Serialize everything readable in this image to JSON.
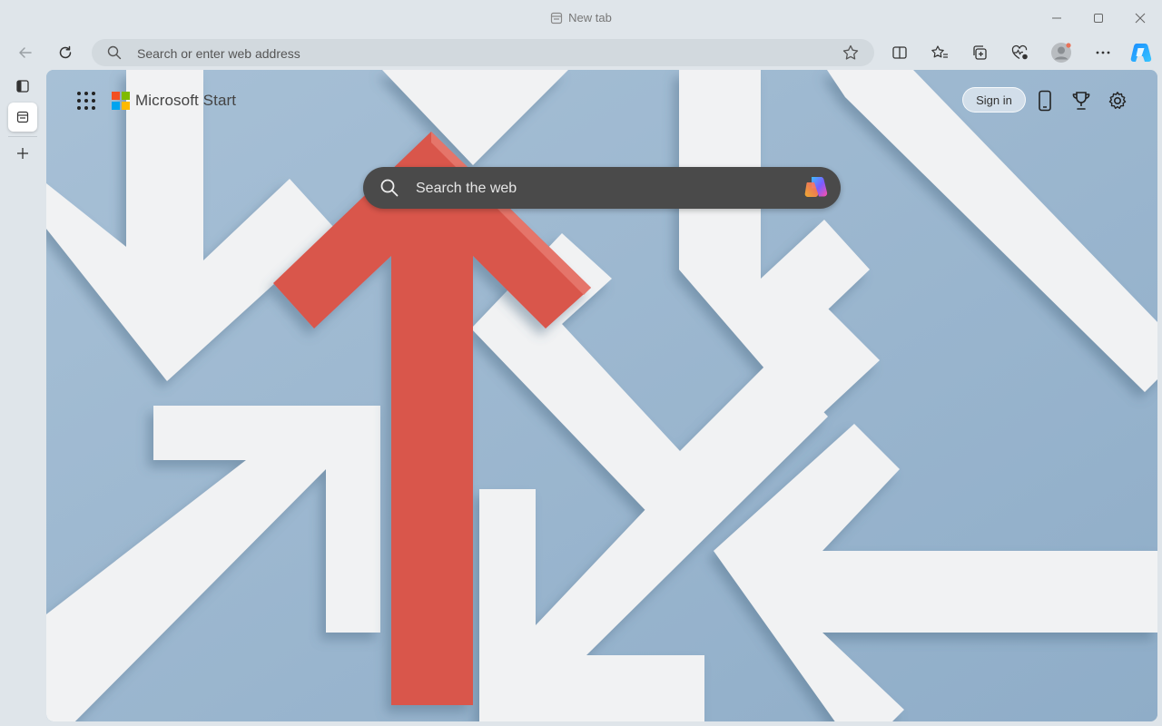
{
  "window": {
    "tab_title": "New tab"
  },
  "address_bar": {
    "placeholder": "Search or enter web address"
  },
  "page": {
    "brand": "Microsoft Start",
    "sign_in": "Sign in",
    "search_placeholder": "Search the web"
  },
  "icons": {
    "titlebar": [
      "tab-icon",
      "minimize-icon",
      "maximize-icon",
      "close-icon"
    ],
    "toolbar": [
      "back-icon",
      "refresh-icon",
      "search-icon",
      "favorite-star-icon",
      "split-screen-icon",
      "favorites-icon",
      "collections-icon",
      "browser-essentials-icon",
      "profile-icon",
      "more-icon",
      "copilot-icon"
    ],
    "sidebar": [
      "tab-actions-icon",
      "tab-icon",
      "new-tab-plus-icon"
    ],
    "page": [
      "apps-grid-icon",
      "microsoft-logo",
      "phone-icon",
      "rewards-trophy-icon",
      "settings-gear-icon",
      "search-icon",
      "copilot-icon"
    ]
  },
  "colors": {
    "chrome_bg": "#dfe5ea",
    "address_bg": "#d2d9de",
    "wallpaper_bg": "#9db8cf",
    "red_arrow": "#d9564b",
    "white_arrow": "#f1f2f3",
    "search_box": "#4a4a4a",
    "ms_red": "#f25022",
    "ms_green": "#7fba00",
    "ms_blue": "#00a4ef",
    "ms_yellow": "#ffb900"
  }
}
